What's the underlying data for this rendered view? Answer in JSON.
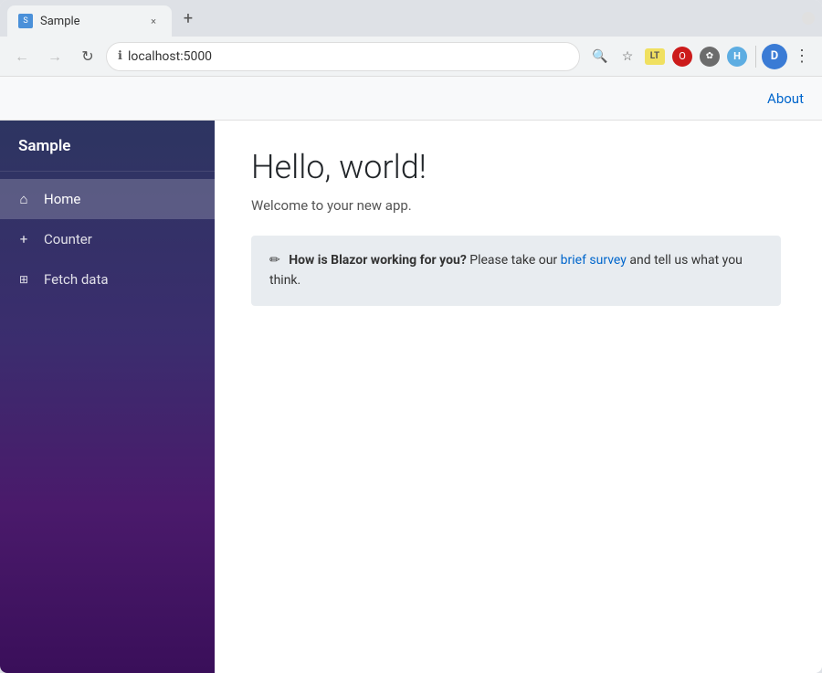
{
  "browser": {
    "tab_favicon": "S",
    "tab_title": "Sample",
    "tab_close": "×",
    "new_tab": "+",
    "back_btn": "←",
    "forward_btn": "→",
    "reload_btn": "↻",
    "address": "localhost:5000",
    "search_icon": "🔍",
    "star_icon": "☆",
    "lt_label": "LT",
    "opera_label": "O",
    "ext_label": "✿",
    "h_label": "H",
    "avatar_label": "D",
    "more_icon": "⋮",
    "window_close": "×"
  },
  "app": {
    "brand": "Sample",
    "about_link": "About",
    "nav": [
      {
        "id": "home",
        "icon": "⌂",
        "label": "Home",
        "active": true
      },
      {
        "id": "counter",
        "icon": "+",
        "label": "Counter",
        "active": false
      },
      {
        "id": "fetch-data",
        "icon": "⊞",
        "label": "Fetch data",
        "active": false
      }
    ],
    "page": {
      "heading": "Hello, world!",
      "subtext": "Welcome to your new app.",
      "survey_pencil": "✏",
      "survey_bold": "How is Blazor working for you?",
      "survey_pre": " Please take our ",
      "survey_link_text": "brief survey",
      "survey_post": " and tell us what you think."
    }
  }
}
